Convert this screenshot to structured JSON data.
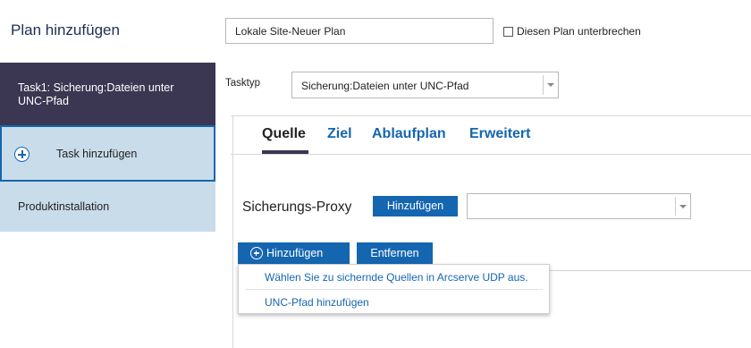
{
  "header": {
    "title": "Plan hinzufügen",
    "plan_name_value": "Lokale Site-Neuer Plan",
    "pause_label": "Diesen Plan unterbrechen",
    "pause_checked": false
  },
  "sidebar": {
    "items": [
      {
        "label": "Task1: Sicherung:Dateien unter UNC-Pfad",
        "active": true
      },
      {
        "label": "Task hinzufügen",
        "icon": "plus-circle-icon"
      },
      {
        "label": "Produktinstallation"
      }
    ]
  },
  "tasktype": {
    "label": "Tasktyp",
    "value": "Sicherung:Dateien unter UNC-Pfad"
  },
  "tabs": [
    {
      "label": "Quelle",
      "active": true
    },
    {
      "label": "Ziel"
    },
    {
      "label": "Ablaufplan"
    },
    {
      "label": "Erweitert"
    }
  ],
  "proxy": {
    "label": "Sicherungs-Proxy",
    "add_button": "Hinzufügen",
    "select_value": ""
  },
  "source_actions": {
    "add_button": "Hinzufügen",
    "remove_button": "Entfernen"
  },
  "dropdown": {
    "items": [
      "Wählen Sie zu sichernde Quellen in Arcserve UDP aus.",
      "UNC-Pfad hinzufügen"
    ]
  },
  "colors": {
    "accent": "#1566b0",
    "sidebar_active": "#3b3651",
    "sidebar_item": "#c9dcea",
    "title": "#1d2f55"
  }
}
